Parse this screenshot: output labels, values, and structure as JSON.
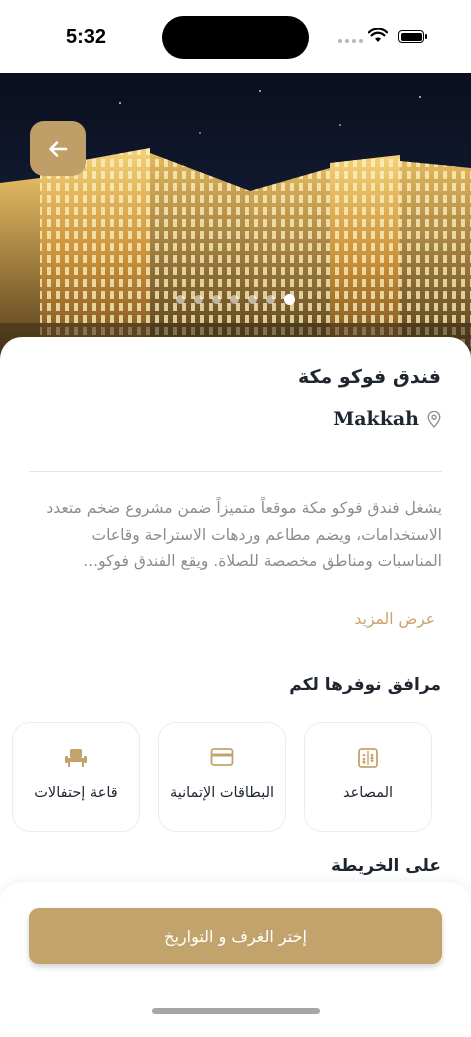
{
  "status_bar": {
    "time": "5:32"
  },
  "hero": {
    "image_count": 7,
    "active_index": 6
  },
  "hotel": {
    "name": "فندق فوكو مكة",
    "city": "Makkah",
    "description": "يشغل فندق فوكو مكة موقعاً متميزاً ضمن مشروع ضخم متعدد الاستخدامات، ويضم مطاعم وردهات الاستراحة وقاعات المناسبات ومناطق مخصصة للصلاة. ويقع الفندق فوكو...",
    "read_more": "عرض المزيد"
  },
  "amenities": {
    "title": "مرافق نوفرها لكم",
    "items": [
      {
        "label": "المصاعد",
        "icon": "elevator-icon"
      },
      {
        "label": "البطاقات الإتمانية",
        "icon": "credit-card-icon"
      },
      {
        "label": "قاعة إحتفالات",
        "icon": "banquet-hall-icon"
      }
    ]
  },
  "map": {
    "title": "على الخريطة"
  },
  "cta": {
    "label": "إختر الغرف و التواريخ"
  },
  "colors": {
    "accent": "#c3a36c",
    "text": "#1f2630",
    "muted": "#8c8c8c",
    "link": "#c6a46a"
  }
}
